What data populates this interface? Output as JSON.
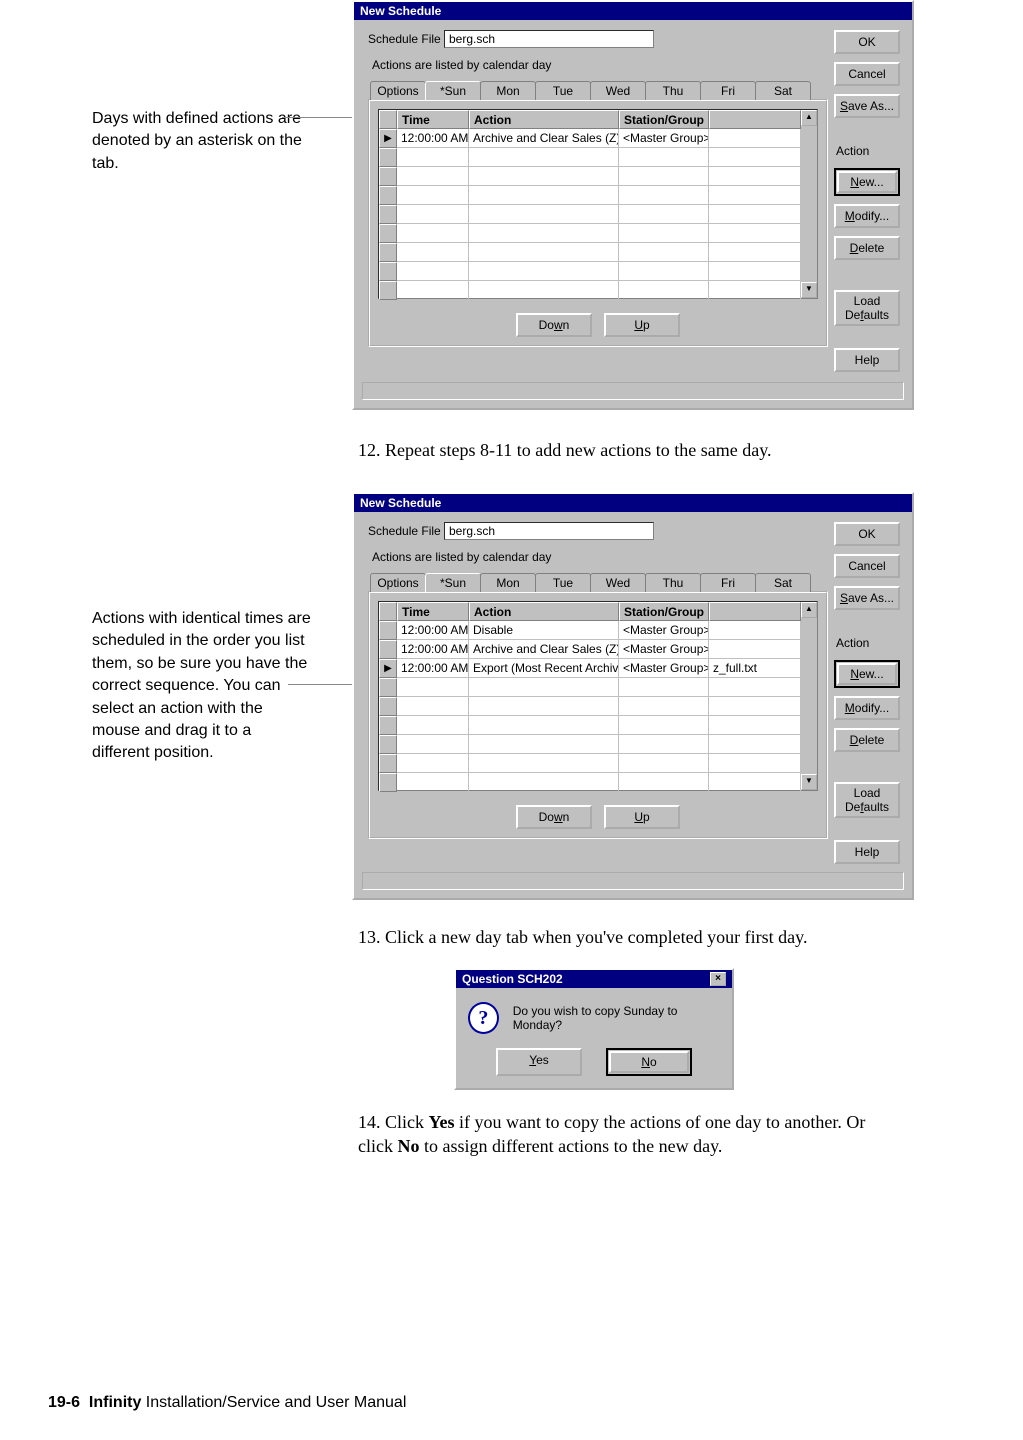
{
  "annotations": {
    "a1": "Days with defined actions are denoted by an asterisk on the tab.",
    "a2": "Actions with identical times are scheduled in the order you list them, so be sure you have the correct sequence. You can select an action with the mouse and drag it to a different position."
  },
  "steps": {
    "s12": "12. Repeat steps 8-11 to add new actions to the same day.",
    "s13": "13. Click a new day tab when you've completed your first day.",
    "s14_a": "14. Click ",
    "s14_yes": "Yes",
    "s14_b": " if you want to copy the actions of one day to another. Or click ",
    "s14_no": "No",
    "s14_c": " to assign different actions to the new day."
  },
  "dialog": {
    "title": "New Schedule",
    "schedule_file_label": "Schedule File",
    "schedule_file_value": "berg.sch",
    "hint": "Actions are listed by calendar day",
    "tabs": [
      "Options",
      "*Sun",
      "Mon",
      "Tue",
      "Wed",
      "Thu",
      "Fri",
      "Sat"
    ],
    "columns": {
      "time": "Time",
      "action": "Action",
      "station": "Station/Group"
    },
    "buttons": {
      "ok": "OK",
      "cancel": "Cancel",
      "save_as": "Save As...",
      "action_label": "Action",
      "new": "New...",
      "modify": "Modify...",
      "delete": "Delete",
      "load_defaults_1": "Load",
      "load_defaults_2": "Defaults",
      "help": "Help",
      "down": "Down",
      "up": "Up"
    }
  },
  "grid1_rows": [
    {
      "time": "12:00:00 AM",
      "action": "Archive and Clear Sales (Z)",
      "station": "<Master Group>",
      "extra": ""
    }
  ],
  "grid2_rows": [
    {
      "time": "12:00:00 AM",
      "action": "Disable",
      "station": "<Master Group>",
      "extra": ""
    },
    {
      "time": "12:00:00 AM",
      "action": "Archive and Clear Sales (Z)",
      "station": "<Master Group>",
      "extra": ""
    },
    {
      "time": "12:00:00 AM",
      "action": "Export (Most Recent Archive)",
      "station": "<Master Group>",
      "extra": "z_full.txt"
    }
  ],
  "msgbox": {
    "title": "Question SCH202",
    "text": "Do you wish to copy Sunday to Monday?",
    "yes": "Yes",
    "no": "No"
  },
  "footer": {
    "page": "19-6",
    "bold": "Infinity",
    "rest": " Installation/Service and User Manual"
  }
}
